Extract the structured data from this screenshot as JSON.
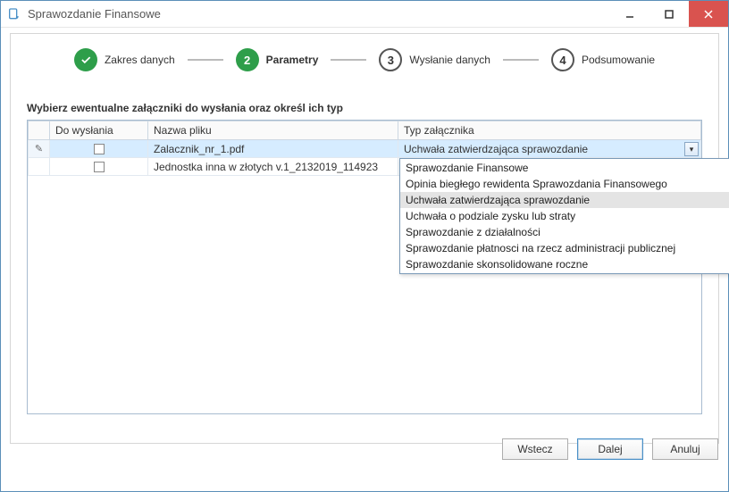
{
  "window": {
    "title": "Sprawozdanie Finansowe"
  },
  "steps": {
    "s1": {
      "label": "Zakres danych"
    },
    "s2": {
      "num": "2",
      "label": "Parametry"
    },
    "s3": {
      "num": "3",
      "label": "Wysłanie danych"
    },
    "s4": {
      "num": "4",
      "label": "Podsumowanie"
    }
  },
  "section_title": "Wybierz ewentualne załączniki do wysłania oraz określ ich typ",
  "columns": {
    "send": "Do wysłania",
    "name": "Nazwa pliku",
    "type": "Typ załącznika"
  },
  "rows": [
    {
      "name": "Zalacznik_nr_1.pdf",
      "type": "Uchwała zatwierdzająca sprawozdanie",
      "editing": true
    },
    {
      "name": "Jednostka inna w złotych v.1_2132019_114923",
      "type": "",
      "editing": false
    }
  ],
  "dropdown": {
    "items": [
      "Sprawozdanie Finansowe",
      "Opinia biegłego rewidenta Sprawozdania Finansowego",
      "Uchwała zatwierdzająca sprawozdanie",
      "Uchwała o podziale zysku lub straty",
      "Sprawozdanie z działalności",
      "Sprawozdanie płatnosci na rzecz administracji publicznej",
      "Sprawozdanie skonsolidowane roczne"
    ],
    "highlight_index": 2
  },
  "buttons": {
    "back": "Wstecz",
    "next": "Dalej",
    "cancel": "Anuluj"
  }
}
